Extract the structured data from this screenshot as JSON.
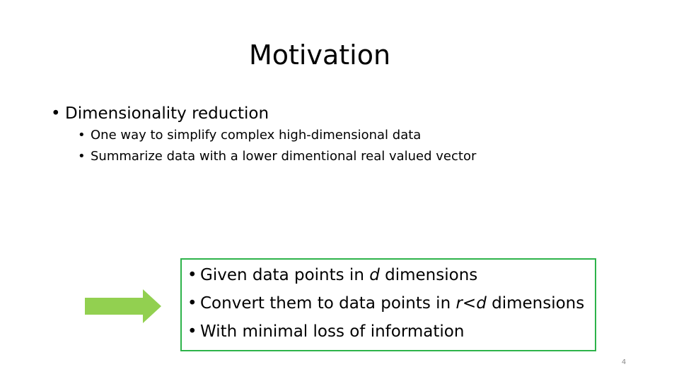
{
  "slide": {
    "title": "Motivation",
    "bullet_symbol": "•",
    "main_bullet": "Dimensionality reduction",
    "sub_bullets": [
      "One way to simplify complex high-dimensional data",
      "Summarize data with a lower dimentional real valued vector"
    ],
    "box_items": [
      {
        "before": "Given data points in ",
        "italic": "d",
        "after": " dimensions"
      },
      {
        "before": "Convert them to data points in ",
        "italic": "r<d",
        "after": " dimensions"
      },
      {
        "before": "With minimal loss of information",
        "italic": "",
        "after": ""
      }
    ],
    "page_number": "4"
  },
  "colors": {
    "arrow": "#92d050",
    "box_border": "#2db34a",
    "page_number": "#8c8c8c"
  },
  "icons": {
    "arrow": "right-arrow-icon"
  }
}
